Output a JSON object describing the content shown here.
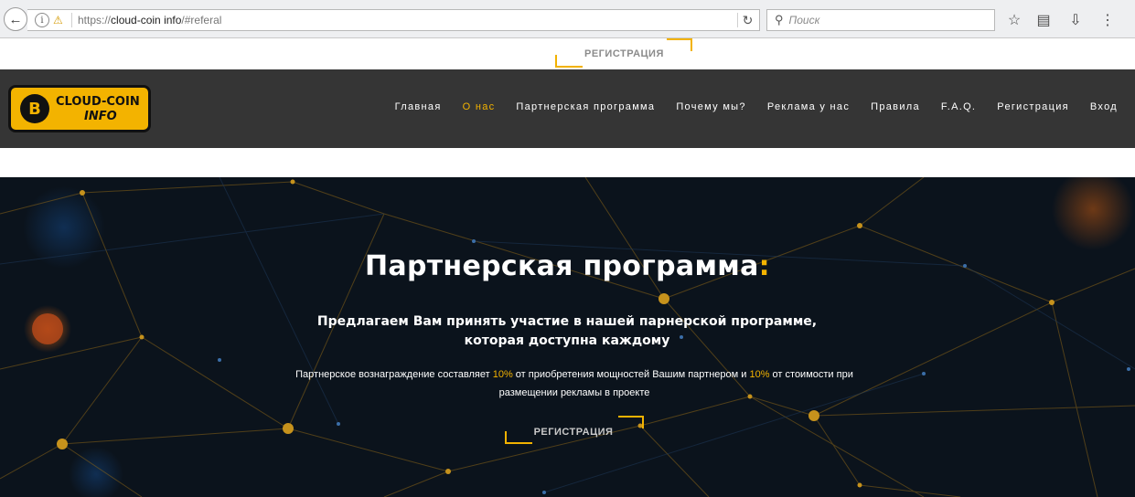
{
  "browser": {
    "url_scheme": "https://",
    "url_host": "cloud-coin info",
    "url_path": "/#referal",
    "search_placeholder": "Поиск"
  },
  "top_strip": {
    "register_label": "РЕГИСТРАЦИЯ"
  },
  "logo": {
    "line1": "CLOUD-COIN",
    "line2": "INFO",
    "coin_symbol": "B"
  },
  "nav": {
    "items": [
      {
        "label": "Главная",
        "active": false
      },
      {
        "label": "О нас",
        "active": true
      },
      {
        "label": "Партнерская программа",
        "active": false
      },
      {
        "label": "Почему мы?",
        "active": false
      },
      {
        "label": "Реклама у нас",
        "active": false
      },
      {
        "label": "Правила",
        "active": false
      },
      {
        "label": "F.A.Q.",
        "active": false
      },
      {
        "label": "Регистрация",
        "active": false
      },
      {
        "label": "Вход",
        "active": false
      }
    ]
  },
  "hero": {
    "title": "Партнерская программа",
    "title_colon": ":",
    "subtitle": "Предлагаем Вам принять участие в нашей парнерской программе, которая доступна каждому",
    "desc_part1": "Партнерское вознаграждение составляет ",
    "desc_pct1": "10%",
    "desc_part2": " от приобретения мощностей Вашим партнером и ",
    "desc_pct2": "10%",
    "desc_part3": " от стоимости при размещении рекламы в проекте",
    "register_label": "РЕГИСТРАЦИЯ"
  },
  "colors": {
    "accent": "#f3b300",
    "header_bg": "#353535",
    "hero_bg": "#0b131c"
  }
}
